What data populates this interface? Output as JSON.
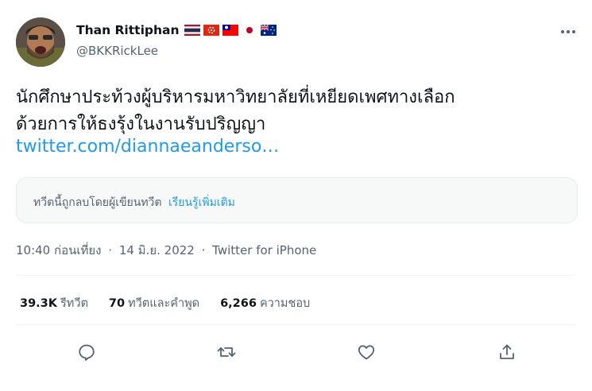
{
  "tweet": {
    "author": {
      "display_name": "Than Rittiphan",
      "handle": "@BKKRickLee",
      "flags": [
        "thailand-flag",
        "hong-kong-flag",
        "taiwan-flag",
        "japan-flag",
        "australia-flag"
      ]
    },
    "text_lines": [
      "นักศึกษาประท้วงผู้บริหารมหาวิทยาลัยที่เหยียดเพศทางเลือก",
      "ด้วยการให้ธงรุ้งในงานรับปริญญา"
    ],
    "link": "twitter.com/diannaeanderso…",
    "deleted_notice": {
      "text": "ทวีตนี้ถูกลบโดยผู้เขียนทวีต",
      "learn_more": "เรียนรู้เพิ่มเติม"
    },
    "meta": {
      "time": "10:40 ก่อนเที่ยง",
      "date": "14 มิ.ย. 2022",
      "separator": "·",
      "source": "Twitter for iPhone"
    },
    "stats": {
      "retweets": {
        "count": "39.3K",
        "label": "รีทวีต"
      },
      "quotes": {
        "count": "70",
        "label": "ทวีตและคำพูด"
      },
      "likes": {
        "count": "6,266",
        "label": "ความชอบ"
      }
    },
    "actions": [
      "reply-icon",
      "retweet-icon",
      "like-icon",
      "share-icon"
    ]
  },
  "colors": {
    "accent": "#1d9bf0",
    "text": "#0f1419",
    "secondary": "#536471",
    "divider": "#eff3f4"
  }
}
